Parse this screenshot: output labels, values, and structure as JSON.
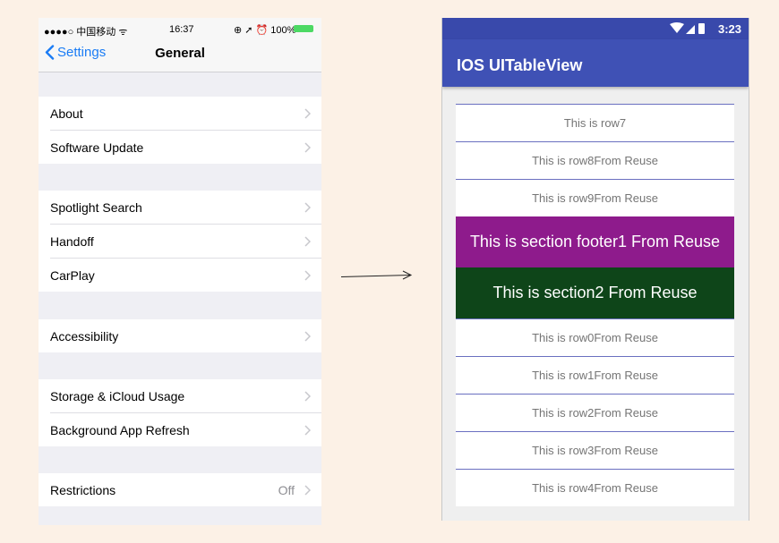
{
  "ios": {
    "status": {
      "carrier": "●●●●○ 中国移动 ᯤ",
      "time": "16:37",
      "right": "⊕ ➚ ⏰ 100%"
    },
    "nav": {
      "back_label": "Settings",
      "title": "General"
    },
    "groups": [
      [
        {
          "label": "About"
        },
        {
          "label": "Software Update"
        }
      ],
      [
        {
          "label": "Spotlight Search"
        },
        {
          "label": "Handoff"
        },
        {
          "label": "CarPlay"
        }
      ],
      [
        {
          "label": "Accessibility"
        }
      ],
      [
        {
          "label": "Storage & iCloud Usage"
        },
        {
          "label": "Background App Refresh"
        }
      ],
      [
        {
          "label": "Restrictions",
          "value": "Off"
        }
      ]
    ]
  },
  "android": {
    "status": {
      "time": "3:23"
    },
    "appbar": {
      "title": "IOS UITableView"
    },
    "items": [
      {
        "kind": "row",
        "text": "This is row7"
      },
      {
        "kind": "row",
        "text": "This is row8From Reuse"
      },
      {
        "kind": "row",
        "text": "This is row9From Reuse"
      },
      {
        "kind": "footer",
        "text": "This is section footer1   From Reuse"
      },
      {
        "kind": "header",
        "text": "This is section2   From Reuse"
      },
      {
        "kind": "row",
        "text": "This is row0From Reuse"
      },
      {
        "kind": "row",
        "text": "This is row1From Reuse"
      },
      {
        "kind": "row",
        "text": "This is row2From Reuse"
      },
      {
        "kind": "row",
        "text": "This is row3From Reuse"
      },
      {
        "kind": "row",
        "text": "This is row4From Reuse"
      }
    ],
    "colors": {
      "appbar": "#3f51b5",
      "footer": "#8e1b8c",
      "header": "#0e4519"
    }
  }
}
